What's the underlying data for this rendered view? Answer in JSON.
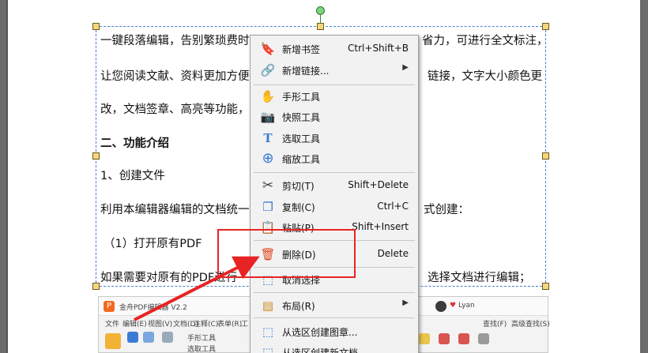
{
  "document": {
    "lines": [
      {
        "text": "一键段落编辑，告别繁琐费时",
        "right": "省力，可进行全文标注，"
      },
      {
        "text": "让您阅读文献、资料更加方便",
        "right": "链接，文字大小颜色更"
      },
      {
        "text": "改，文档签章、高亮等功能，",
        "right": ""
      },
      {
        "text": "二、功能介绍",
        "right": ""
      },
      {
        "text": "1、创建文件",
        "right": ""
      },
      {
        "text": "利用本编辑器编辑的文档统一",
        "right": "式创建："
      },
      {
        "text": "（1）打开原有PDF",
        "right": ""
      },
      {
        "text": "如果需要对原有的PDF进行",
        "right": "选择文档进行编辑；"
      }
    ]
  },
  "thumbnail": {
    "app_title": "金舟PDF编辑器 V2.2",
    "user": "Lyan",
    "menu": [
      "文件",
      "编辑(E)",
      "视图(V)",
      "文档(D)",
      "注释(C)",
      "表单(R)",
      "工"
    ],
    "tools": [
      "手形工具",
      "选取工具"
    ],
    "search": [
      "查找(F)",
      "高级查找(S)"
    ]
  },
  "context_menu": {
    "items": [
      {
        "icon": "bookmark-add-icon",
        "glyph": "🔖",
        "color": "#3a7bd5",
        "label": "新增书签",
        "shortcut": "Ctrl+Shift+B"
      },
      {
        "icon": "link-add-icon",
        "glyph": "🔗",
        "color": "#c98a1c",
        "label": "新增链接...",
        "submenu": true
      },
      {
        "icon": "hand-icon",
        "glyph": "✋",
        "color": "#555555",
        "label": "手形工具"
      },
      {
        "icon": "camera-icon",
        "glyph": "📷",
        "color": "#3a7bd5",
        "label": "快照工具"
      },
      {
        "icon": "text-select-icon",
        "glyph": "T",
        "color": "#3a7bd5",
        "label": "选取工具"
      },
      {
        "icon": "zoom-icon",
        "glyph": "⊕",
        "color": "#3a7bd5",
        "label": "缩放工具"
      },
      {
        "icon": "scissors-icon",
        "glyph": "✂",
        "color": "#444444",
        "label": "剪切(T)",
        "shortcut": "Shift+Delete"
      },
      {
        "icon": "copy-icon",
        "glyph": "❐",
        "color": "#3a7bd5",
        "label": "复制(C)",
        "shortcut": "Ctrl+C"
      },
      {
        "icon": "paste-icon",
        "glyph": "📋",
        "color": "#c98a1c",
        "label": "粘贴(P)",
        "shortcut": "Shift+Insert"
      },
      {
        "icon": "trash-icon",
        "glyph": "🗑",
        "color": "#e0481e",
        "label": "删除(D)",
        "shortcut": "Delete"
      },
      {
        "icon": "deselect-icon",
        "glyph": "⬚",
        "color": "#3a7bd5",
        "label": "取消选择"
      },
      {
        "icon": "layout-icon",
        "glyph": "▤",
        "color": "#c98a1c",
        "label": "布局(R)",
        "submenu": true
      },
      {
        "icon": "stamp-icon",
        "glyph": "⬚",
        "color": "#3a7bd5",
        "label": "从选区创建图章..."
      },
      {
        "icon": "new-doc-icon",
        "glyph": "⬚",
        "color": "#3a7bd5",
        "label": "从选区创建新文档"
      }
    ]
  }
}
